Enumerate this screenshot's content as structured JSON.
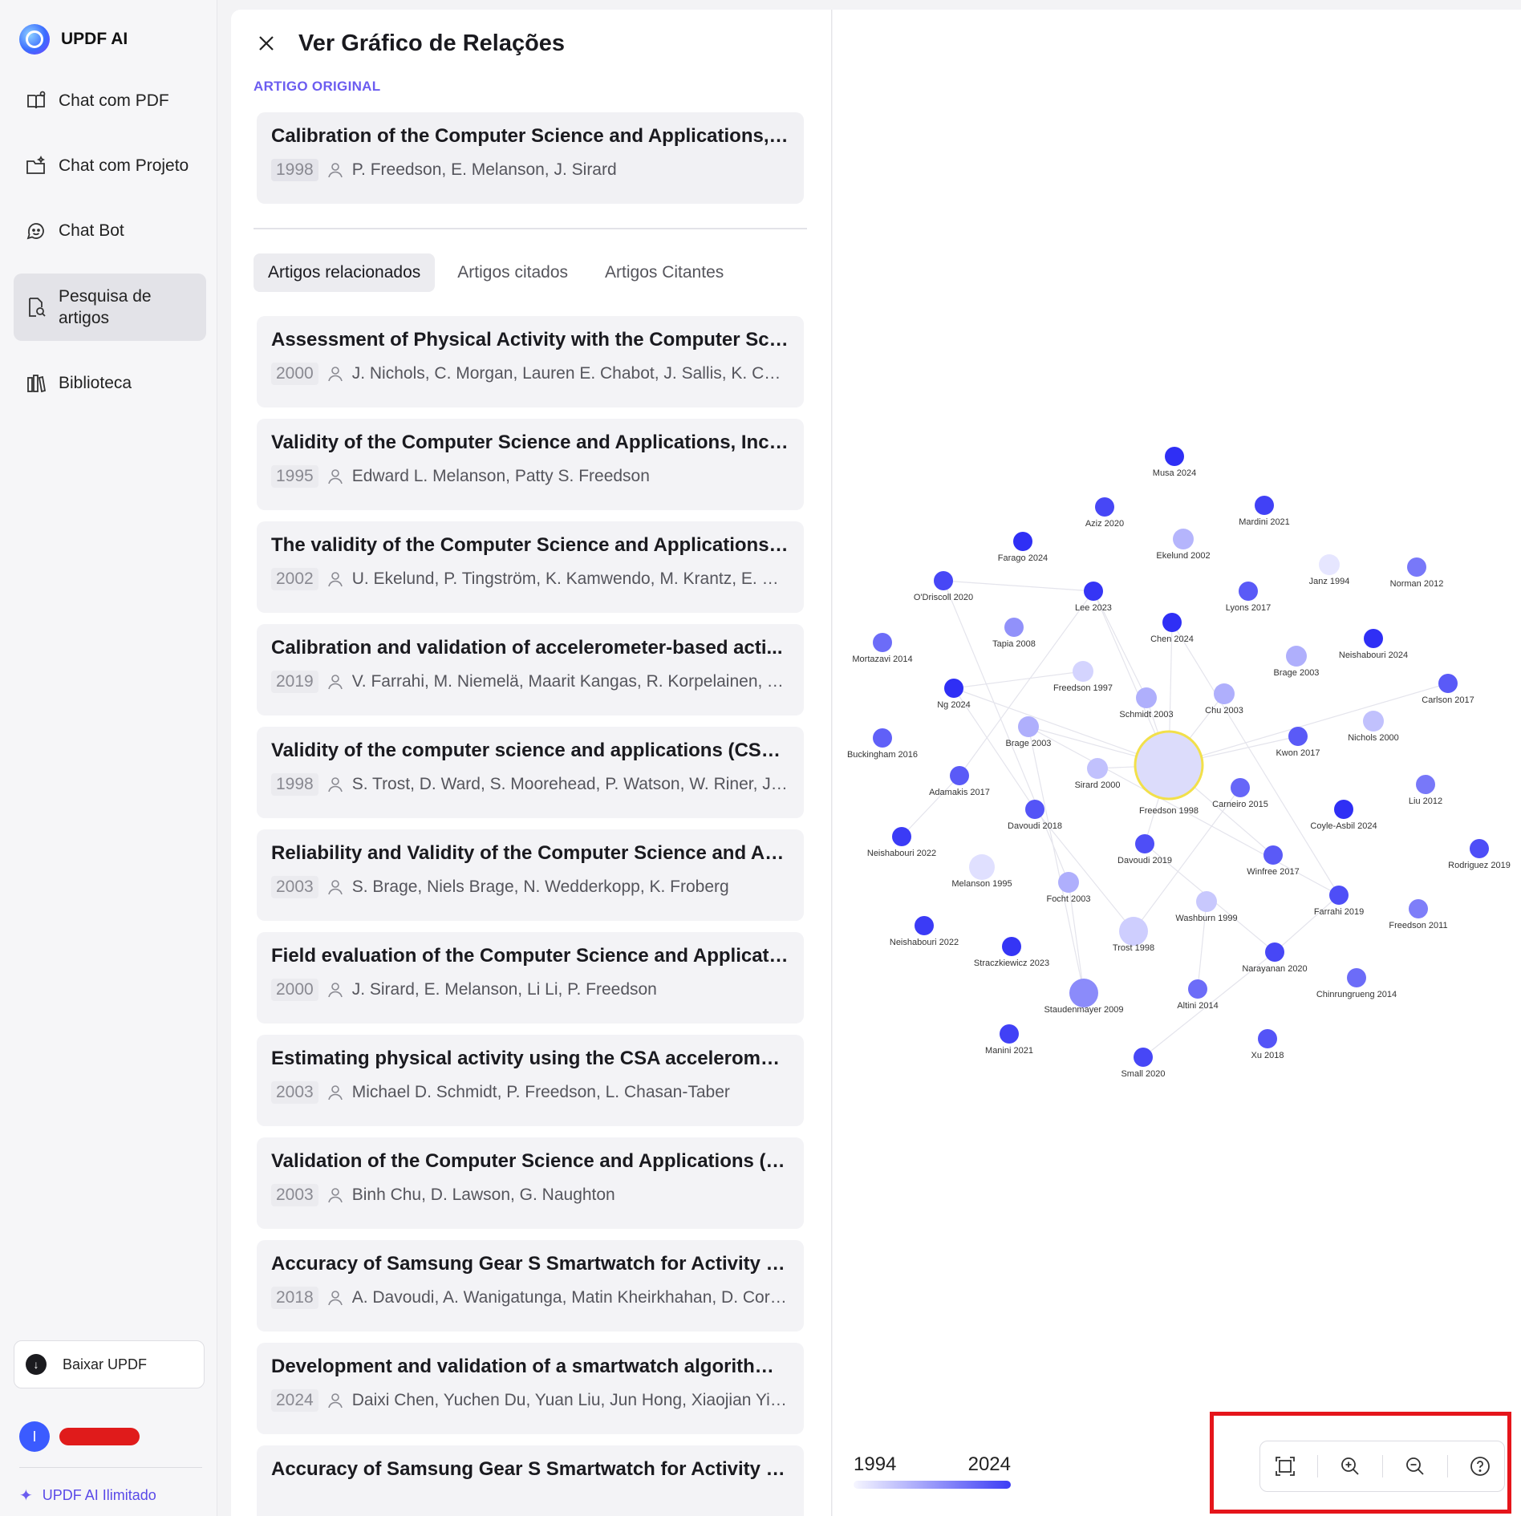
{
  "sidebar": {
    "brand": "UPDF AI",
    "items": [
      {
        "label": "Chat com PDF",
        "icon": "book-chat-icon"
      },
      {
        "label": "Chat com Projeto",
        "icon": "folder-chat-icon"
      },
      {
        "label": "Chat Bot",
        "icon": "bot-icon"
      },
      {
        "label": "Pesquisa de artigos",
        "icon": "paper-search-icon",
        "active": true
      },
      {
        "label": "Biblioteca",
        "icon": "library-icon"
      }
    ],
    "download": "Baixar UPDF",
    "avatar_initial": "I",
    "unlimited": "UPDF AI Ilimitado"
  },
  "panel": {
    "title": "Ver Gráfico de Relações",
    "section_label": "ARTIGO ORIGINAL",
    "original": {
      "title": "Calibration of the Computer Science and Applications, I...",
      "year": "1998",
      "authors": "P. Freedson, E. Melanson, J. Sirard"
    },
    "tabs": [
      "Artigos relacionados",
      "Artigos citados",
      "Artigos Citantes"
    ],
    "items": [
      {
        "title": "Assessment of Physical Activity with the Computer Scie...",
        "year": "2000",
        "authors": "J. Nichols, C. Morgan, Lauren E. Chabot, J. Sallis, K. Cal..."
      },
      {
        "title": "Validity of the Computer Science and Applications, Inc. ...",
        "year": "1995",
        "authors": "Edward L. Melanson, Patty S. Freedson"
      },
      {
        "title": "The validity of the Computer Science and Applications ...",
        "year": "2002",
        "authors": "U. Ekelund, P. Tingström, K. Kamwendo, M. Krantz, E. Ny..."
      },
      {
        "title": "Calibration and validation of accelerometer-based acti...",
        "year": "2019",
        "authors": "V. Farrahi, M. Niemelä, Maarit Kangas, R. Korpelainen, T. ..."
      },
      {
        "title": "Validity of the computer science and applications (CSA...",
        "year": "1998",
        "authors": "S. Trost, D. Ward, S. Moorehead, P. Watson, W. Riner, J. B..."
      },
      {
        "title": "Reliability and Validity of the Computer Science and Ap...",
        "year": "2003",
        "authors": "S. Brage, Niels Brage, N. Wedderkopp, K. Froberg"
      },
      {
        "title": "Field evaluation of the Computer Science and Applicati...",
        "year": "2000",
        "authors": "J. Sirard, E. Melanson, Li Li, P. Freedson"
      },
      {
        "title": "Estimating physical activity using the CSA acceleromet...",
        "year": "2003",
        "authors": "Michael D. Schmidt, P. Freedson, L. Chasan-Taber"
      },
      {
        "title": "Validation of the Computer Science and Applications (C...",
        "year": "2003",
        "authors": "Binh Chu, D. Lawson, G. Naughton"
      },
      {
        "title": "Accuracy of Samsung Gear S Smartwatch for Activity R...",
        "year": "2018",
        "authors": "A. Davoudi, A. Wanigatunga, Matin Kheirkhahan, D. Corb..."
      },
      {
        "title": "Development and validation of a smartwatch algorithm ...",
        "year": "2024",
        "authors": "Daixi Chen, Yuchen Du, Yuan Liu, Jun Hong, Xiaojian Yin,..."
      },
      {
        "title": "Accuracy of Samsung Gear S Smartwatch for Activity R...",
        "year": "",
        "authors": ""
      }
    ]
  },
  "graph": {
    "year_min": 1994,
    "year_max": 2024,
    "legend_min": "1994",
    "legend_max": "2024",
    "color_new": "#2f2ff5",
    "color_old": "#d8d8ff",
    "center_ring": "#f2e04a",
    "nodes": [
      {
        "id": "freedson1998",
        "label": "Freedson 1998",
        "year": 1998,
        "center": true
      },
      {
        "id": "musa2024",
        "label": "Musa 2024",
        "year": 2024
      },
      {
        "id": "aziz2020",
        "label": "Aziz 2020",
        "year": 2020
      },
      {
        "id": "mardini2021",
        "label": "Mardini 2021",
        "year": 2021
      },
      {
        "id": "farago2024",
        "label": "Farago 2024",
        "year": 2024
      },
      {
        "id": "ekelund2002",
        "label": "Ekelund 2002",
        "year": 2002
      },
      {
        "id": "janz1994",
        "label": "Janz 1994",
        "year": 1994
      },
      {
        "id": "norman2012",
        "label": "Norman 2012",
        "year": 2012
      },
      {
        "id": "odriscoll2020",
        "label": "O'Driscoll 2020",
        "year": 2020
      },
      {
        "id": "lee2023",
        "label": "Lee 2023",
        "year": 2023
      },
      {
        "id": "lyons2017",
        "label": "Lyons 2017",
        "year": 2017
      },
      {
        "id": "tapia2008",
        "label": "Tapia 2008",
        "year": 2008
      },
      {
        "id": "chen2024",
        "label": "Chen 2024",
        "year": 2024
      },
      {
        "id": "mortazavi2014",
        "label": "Mortazavi 2014",
        "year": 2014
      },
      {
        "id": "neishabouri2024",
        "label": "Neishabouri 2024",
        "year": 2024
      },
      {
        "id": "brage2003a",
        "label": "Brage 2003",
        "year": 2003
      },
      {
        "id": "freedson1997",
        "label": "Freedson 1997",
        "year": 1997
      },
      {
        "id": "carlson2017",
        "label": "Carlson 2017",
        "year": 2017
      },
      {
        "id": "ng2024",
        "label": "Ng 2024",
        "year": 2024
      },
      {
        "id": "schmidt2003",
        "label": "Schmidt 2003",
        "year": 2003
      },
      {
        "id": "chu2003",
        "label": "Chu 2003",
        "year": 2003
      },
      {
        "id": "brage2003b",
        "label": "Brage 2003",
        "year": 2003
      },
      {
        "id": "nichols2000",
        "label": "Nichols 2000",
        "year": 2000
      },
      {
        "id": "buckingham2016",
        "label": "Buckingham 2016",
        "year": 2016
      },
      {
        "id": "kwon2017",
        "label": "Kwon 2017",
        "year": 2017
      },
      {
        "id": "sirard2000",
        "label": "Sirard 2000",
        "year": 2000
      },
      {
        "id": "adamakis2017",
        "label": "Adamakis 2017",
        "year": 2017
      },
      {
        "id": "carneiro2015",
        "label": "Carneiro 2015",
        "year": 2015
      },
      {
        "id": "liu2012",
        "label": "Liu 2012",
        "year": 2012
      },
      {
        "id": "davoudi2018",
        "label": "Davoudi 2018",
        "year": 2018
      },
      {
        "id": "coyleasbil2024",
        "label": "Coyle-Asbil 2024",
        "year": 2024
      },
      {
        "id": "neishabouri2022a",
        "label": "Neishabouri 2022",
        "year": 2022
      },
      {
        "id": "davoudi2019",
        "label": "Davoudi 2019",
        "year": 2019
      },
      {
        "id": "winfree2017",
        "label": "Winfree 2017",
        "year": 2017
      },
      {
        "id": "rodriguez2019",
        "label": "Rodriguez 2019",
        "year": 2019
      },
      {
        "id": "melanson1995",
        "label": "Melanson 1995",
        "year": 1995
      },
      {
        "id": "focht2003",
        "label": "Focht 2003",
        "year": 2003
      },
      {
        "id": "washburn1999",
        "label": "Washburn 1999",
        "year": 1999
      },
      {
        "id": "farrahi2019",
        "label": "Farrahi 2019",
        "year": 2019
      },
      {
        "id": "freedson2011",
        "label": "Freedson 2011",
        "year": 2011
      },
      {
        "id": "neishabouri2022b",
        "label": "Neishabouri 2022",
        "year": 2022
      },
      {
        "id": "trost1998",
        "label": "Trost 1998",
        "year": 1998
      },
      {
        "id": "straczkiewicz2023",
        "label": "Straczkiewicz 2023",
        "year": 2023
      },
      {
        "id": "narayanan2020",
        "label": "Narayanan 2020",
        "year": 2020
      },
      {
        "id": "chinrungrueng2014",
        "label": "Chinrungrueng 2014",
        "year": 2014
      },
      {
        "id": "staudenmayer2009",
        "label": "Staudenmayer 2009",
        "year": 2009
      },
      {
        "id": "altini2014",
        "label": "Altini 2014",
        "year": 2014
      },
      {
        "id": "manini2021",
        "label": "Manini 2021",
        "year": 2021
      },
      {
        "id": "xu2018",
        "label": "Xu 2018",
        "year": 2018
      },
      {
        "id": "small2020",
        "label": "Small 2020",
        "year": 2020
      }
    ]
  },
  "toolbar": {
    "fit": "fit-screen-icon",
    "zoom_in": "zoom-in-icon",
    "zoom_out": "zoom-out-icon",
    "help": "help-icon"
  }
}
